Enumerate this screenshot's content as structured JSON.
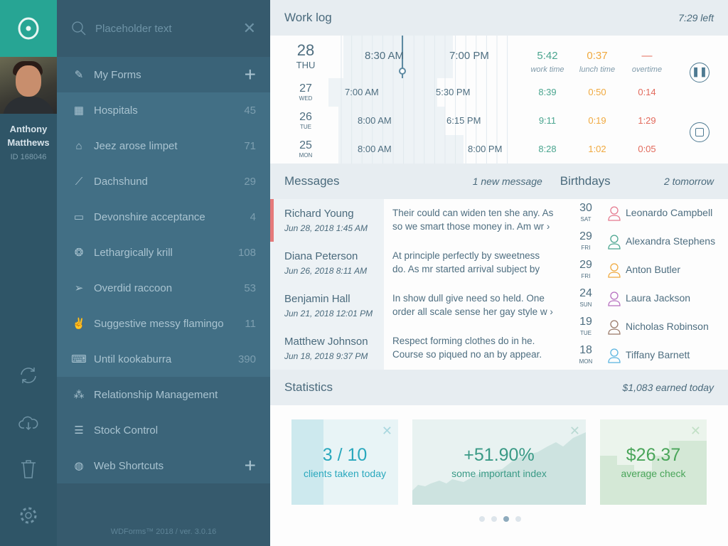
{
  "user": {
    "name_line1": "Anthony",
    "name_line2": "Matthews",
    "id": "ID 168046"
  },
  "search": {
    "placeholder": "Placeholder text"
  },
  "sidebar": {
    "my_forms": "My Forms",
    "items": [
      {
        "label": "Hospitals",
        "count": "45",
        "icon": "building-icon"
      },
      {
        "label": "Jeez arose limpet",
        "count": "71",
        "icon": "factory-icon"
      },
      {
        "label": "Dachshund",
        "count": "29",
        "icon": "bone-icon"
      },
      {
        "label": "Devonshire acceptance",
        "count": "4",
        "icon": "monitor-icon"
      },
      {
        "label": "Lethargically krill",
        "count": "108",
        "icon": "brain-icon"
      },
      {
        "label": "Overdid raccoon",
        "count": "53",
        "icon": "paper-plane-icon"
      },
      {
        "label": "Suggestive messy flamingo",
        "count": "11",
        "icon": "peace-hand-icon"
      },
      {
        "label": "Until kookaburra",
        "count": "390",
        "icon": "typewriter-icon"
      }
    ],
    "sections": [
      {
        "label": "Relationship Management",
        "icon": "network-icon"
      },
      {
        "label": "Stock Control",
        "icon": "checklist-icon"
      },
      {
        "label": "Web Shortcuts",
        "icon": "globe-icon"
      }
    ],
    "footer": "WDForms™ 2018 / ver. 3.0.16"
  },
  "worklog": {
    "title": "Work log",
    "time_left": "7:29 left",
    "captions": {
      "work": "work time",
      "lunch": "lunch time",
      "overtime": "overtime"
    },
    "days": [
      {
        "day": "28",
        "dow": "THU",
        "start": "8:30 AM",
        "end": "7:00 PM",
        "work": "5:42",
        "lunch": "0:37",
        "overtime": "—"
      },
      {
        "day": "27",
        "dow": "WED",
        "start": "7:00 AM",
        "end": "5:30 PM",
        "work": "8:39",
        "lunch": "0:50",
        "overtime": "0:14"
      },
      {
        "day": "26",
        "dow": "TUE",
        "start": "8:00 AM",
        "end": "6:15 PM",
        "work": "9:11",
        "lunch": "0:19",
        "overtime": "1:29"
      },
      {
        "day": "25",
        "dow": "MON",
        "start": "8:00 AM",
        "end": "8:00 PM",
        "work": "8:28",
        "lunch": "1:02",
        "overtime": "0:05"
      }
    ]
  },
  "messages": {
    "title": "Messages",
    "status": "1 new message",
    "items": [
      {
        "name": "Richard Young",
        "date": "Jun 28, 2018 1:45 AM",
        "text1": "Their could can widen ten she any. As",
        "text2": "so we smart those money in. Am wr ›"
      },
      {
        "name": "Diana Peterson",
        "date": "Jun 26, 2018 8:11 AM",
        "text1": "At principle perfectly by sweetness",
        "text2": "do. As mr started arrival subject by"
      },
      {
        "name": "Benjamin Hall",
        "date": "Jun 21, 2018 12:01 PM",
        "text1": "In show dull give need so held. One",
        "text2": "order all scale sense her gay style w ›"
      },
      {
        "name": "Matthew Johnson",
        "date": "Jun 18, 2018 9:37 PM",
        "text1": "Respect forming clothes do in he.",
        "text2": "Course so piqued no an by appear."
      }
    ]
  },
  "birthdays": {
    "title": "Birthdays",
    "status": "2 tomorrow",
    "items": [
      {
        "day": "30",
        "dow": "SAT",
        "name": "Leonardo Campbell",
        "color": "#e57a8f"
      },
      {
        "day": "29",
        "dow": "FRI",
        "name": "Alexandra Stephens",
        "color": "#4aa58f"
      },
      {
        "day": "29",
        "dow": "FRI",
        "name": "Anton Butler",
        "color": "#f0a93f"
      },
      {
        "day": "24",
        "dow": "SUN",
        "name": "Laura Jackson",
        "color": "#b76fc0"
      },
      {
        "day": "19",
        "dow": "TUE",
        "name": "Nicholas Robinson",
        "color": "#9a7a6a"
      },
      {
        "day": "18",
        "dow": "MON",
        "name": "Tiffany Barnett",
        "color": "#5ab4e0"
      }
    ]
  },
  "statistics": {
    "title": "Statistics",
    "earned": "$1,083 earned today",
    "cards": [
      {
        "value": "3 / 10",
        "label": "clients taken today",
        "progress": 0.3
      },
      {
        "value": "+51.90%",
        "label": "some important index"
      },
      {
        "value": "$26.37",
        "label": "average check"
      }
    ],
    "page_dots": 4,
    "active_dot": 3
  },
  "colors": {
    "accent": "#27a594",
    "work": "#4aa58f",
    "lunch": "#f0a93f",
    "overtime": "#e26a5c",
    "unread": "#e57a7a"
  }
}
